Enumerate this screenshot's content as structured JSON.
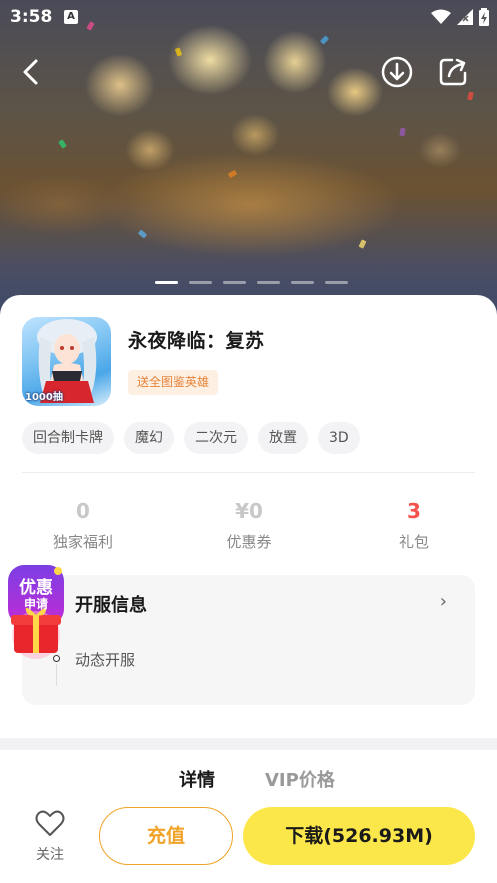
{
  "status_bar": {
    "time": "3:58",
    "notification_icon": "a-letter-icon",
    "icons": [
      "wifi-icon",
      "signal-icon",
      "battery-charging-icon"
    ]
  },
  "nav": {
    "back_icon": "chevron-left-icon",
    "download_icon": "download-circle-icon",
    "share_icon": "share-icon"
  },
  "carousel": {
    "slide_count": 6,
    "active_index": 0
  },
  "app": {
    "name": "永夜降临：复苏",
    "promo_badge": "送全图鉴英雄",
    "icon_caption": "1000抽",
    "tags": [
      "回合制卡牌",
      "魔幻",
      "二次元",
      "放置",
      "3D"
    ]
  },
  "stats": [
    {
      "value": "0",
      "label": "独家福利"
    },
    {
      "value": "¥0",
      "label": "优惠券"
    },
    {
      "value": "3",
      "label": "礼包"
    }
  ],
  "server": {
    "title": "开服信息",
    "item": "动态开服"
  },
  "promo_float": {
    "line1": "优惠",
    "line2": "申请"
  },
  "tabs": [
    {
      "label": "详情",
      "active": true
    },
    {
      "label": "VIP价格",
      "active": false
    }
  ],
  "bottom_bar": {
    "follow_label": "关注",
    "recharge_label": "充值",
    "download_label": "下载(526.93M)"
  },
  "colors": {
    "accent_yellow": "#fce74a",
    "accent_orange": "#f0a326",
    "stat_red": "#f4534e",
    "badge_text": "#e8833a",
    "badge_bg": "#fdf0e3"
  }
}
